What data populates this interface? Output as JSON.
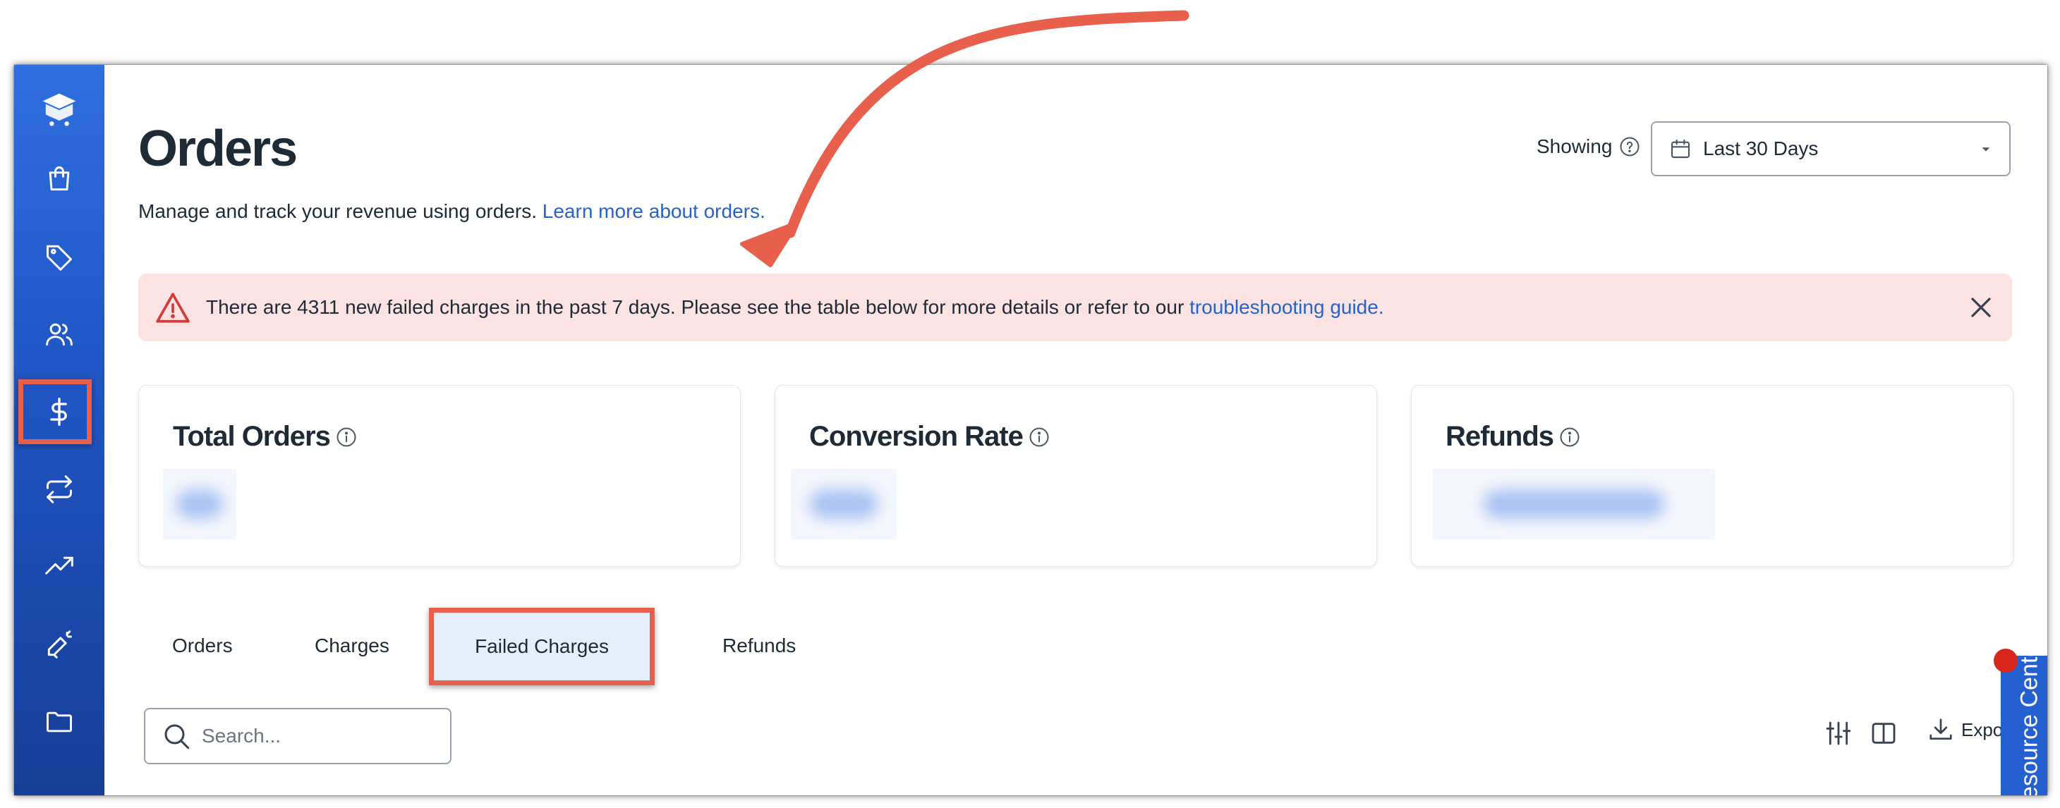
{
  "page": {
    "title": "Orders",
    "subtitle": "Manage and track your revenue using orders.",
    "subtitle_link": "Learn more about orders."
  },
  "filter": {
    "label": "Showing",
    "selected": "Last 30 Days"
  },
  "alert": {
    "message": "There are 4311 new failed charges in the past 7 days. Please see the table below for more details or refer to our",
    "link": "troubleshooting guide."
  },
  "cards": [
    {
      "title": "Total Orders"
    },
    {
      "title": "Conversion Rate"
    },
    {
      "title": "Refunds"
    }
  ],
  "tabs": [
    {
      "label": "Orders"
    },
    {
      "label": "Charges"
    },
    {
      "label": "Failed Charges",
      "active": true
    },
    {
      "label": "Refunds"
    }
  ],
  "search": {
    "placeholder": "Search..."
  },
  "toolbar": {
    "export_label": "Export"
  },
  "resource_center": {
    "label": "Resource Center"
  },
  "sidebar": {
    "items": [
      {
        "icon": "shopping-bag-icon"
      },
      {
        "icon": "tag-icon"
      },
      {
        "icon": "users-icon"
      },
      {
        "icon": "dollar-icon",
        "active": true
      },
      {
        "icon": "repeat-icon"
      },
      {
        "icon": "trending-up-icon"
      },
      {
        "icon": "megaphone-icon"
      },
      {
        "icon": "folder-icon"
      }
    ]
  },
  "colors": {
    "sidebar_top": "#2f6fe0",
    "sidebar_bottom": "#163e96",
    "link": "#2563c9",
    "alert_bg": "#fbe3e3",
    "alert_icon": "#d23b3b",
    "highlight": "#e8604c",
    "active_tab_bg": "#e3f0fb",
    "resource_center": "#2460d0"
  }
}
